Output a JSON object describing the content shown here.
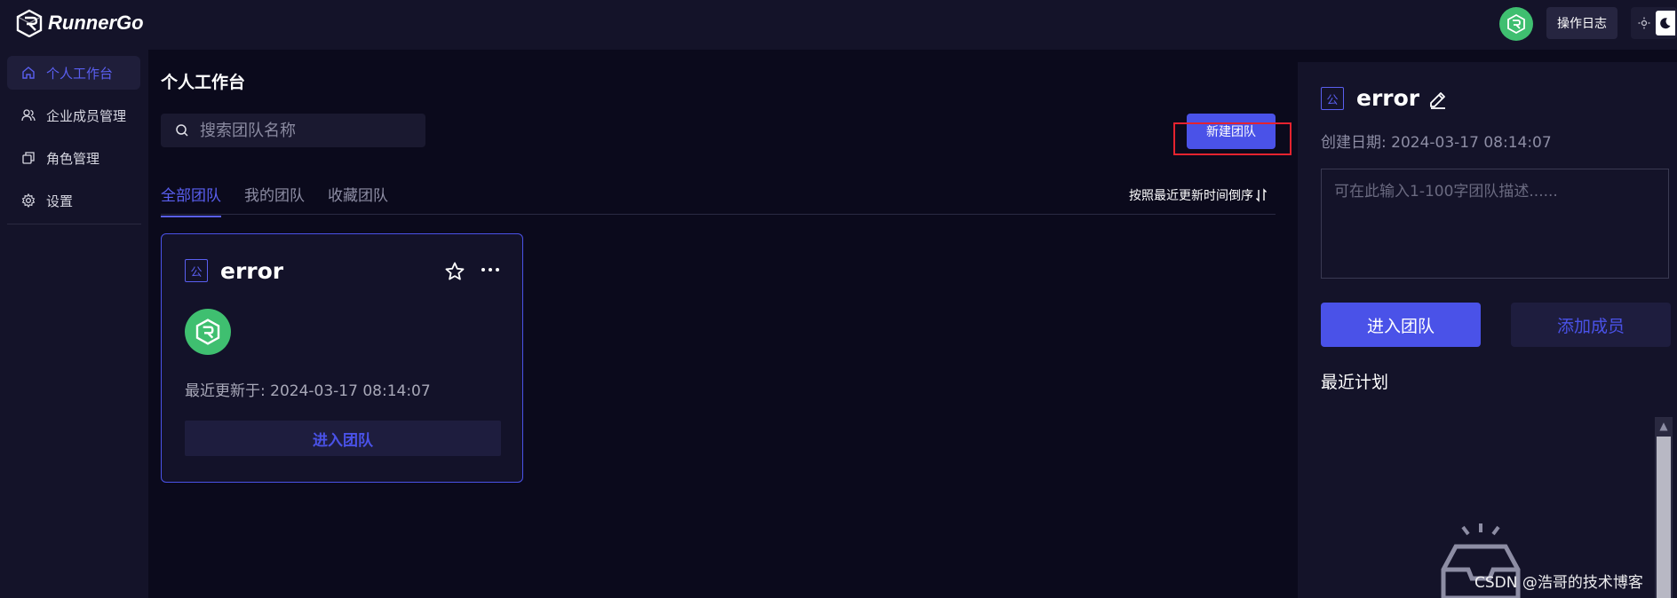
{
  "header": {
    "app_name": "RunnerGo",
    "oplog_label": "操作日志",
    "logo_icon": "runnergo-logo-icon",
    "avatar_icon": "cube-avatar-icon",
    "theme_icons": [
      "sun-icon",
      "moon-icon"
    ]
  },
  "sidebar": {
    "items": [
      {
        "label": "个人工作台",
        "icon": "home-icon",
        "active": true
      },
      {
        "label": "企业成员管理",
        "icon": "users-icon",
        "active": false
      },
      {
        "label": "角色管理",
        "icon": "roles-icon",
        "active": false
      },
      {
        "label": "设置",
        "icon": "gear-icon",
        "active": false
      }
    ]
  },
  "main": {
    "title": "个人工作台",
    "search_placeholder": "搜索团队名称",
    "new_team_label": "新建团队",
    "tabs": [
      {
        "label": "全部团队",
        "active": true
      },
      {
        "label": "我的团队",
        "active": false
      },
      {
        "label": "收藏团队",
        "active": false
      }
    ],
    "sort_label": "按照最近更新时间倒序",
    "sort_icon": "sort-icon"
  },
  "team_card": {
    "tag": "公",
    "name": "error",
    "updated": "最近更新于: 2024-03-17 08:14:07",
    "enter_label": "进入团队"
  },
  "detail": {
    "tag": "公",
    "name": "error",
    "created": "创建日期: 2024-03-17 08:14:07",
    "desc_placeholder": "可在此输入1-100字团队描述......",
    "enter_label": "进入团队",
    "add_member_label": "添加成员",
    "recent_plans_label": "最近计划"
  },
  "watermark": "CSDN @浩哥的技术博客",
  "colors": {
    "accent": "#4a52e8",
    "background": "#0b0a1c",
    "panel": "#141329",
    "avatar": "#3fbf70",
    "highlight": "#e5232f"
  }
}
